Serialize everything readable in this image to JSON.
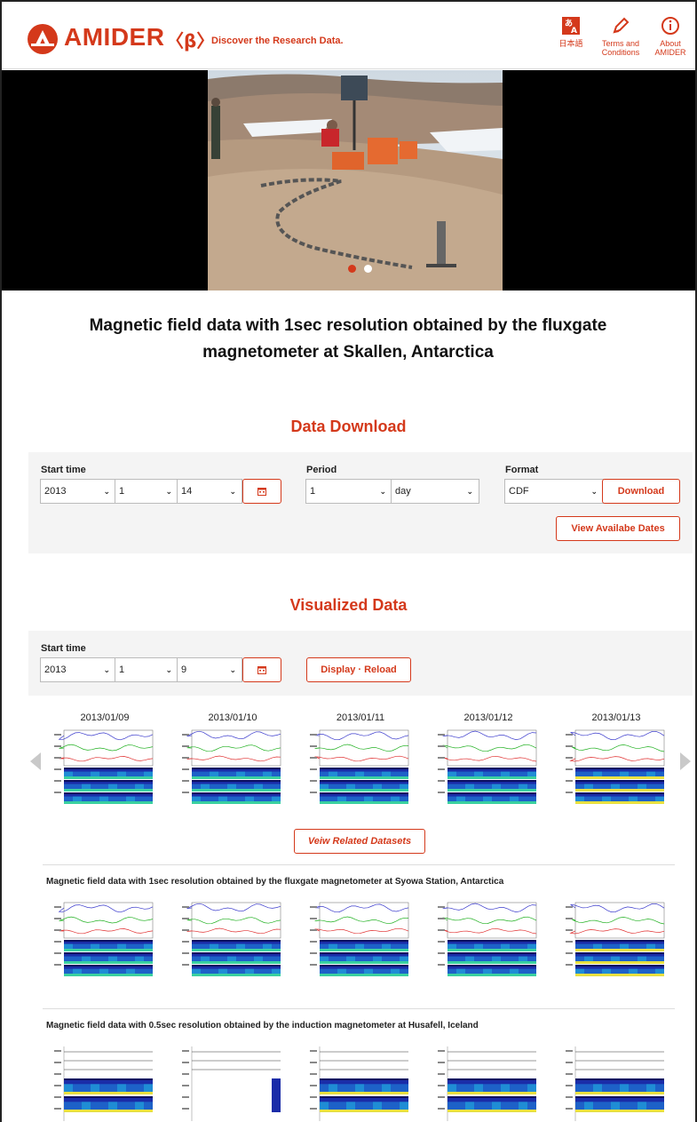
{
  "header": {
    "brand": "AMIDER",
    "beta": "〈β〉",
    "tagline": "Discover the Research Data.",
    "nav": [
      {
        "label": "日本語",
        "icon": "language-icon"
      },
      {
        "label": "Terms and Conditions",
        "icon": "pencil-icon"
      },
      {
        "label": "About AMIDER",
        "icon": "info-icon"
      }
    ],
    "colors": {
      "accent": "#d4391b"
    }
  },
  "hero": {
    "slides": 2,
    "active_slide": 1
  },
  "title": "Magnetic field data with 1sec resolution obtained by the fluxgate magnetometer at Skallen, Antarctica",
  "download": {
    "heading": "Data Download",
    "start_time_label": "Start time",
    "year": "2013",
    "month": "1",
    "day": "14",
    "period_label": "Period",
    "period_value": "1",
    "period_unit": "day",
    "format_label": "Format",
    "format_value": "CDF",
    "download_button": "Download",
    "view_dates_button": "View Availabe Dates"
  },
  "visualized": {
    "heading": "Visualized Data",
    "start_time_label": "Start time",
    "year": "2013",
    "month": "1",
    "day": "9",
    "reload_button": "Display · Reload",
    "dates": [
      "2013/01/09",
      "2013/01/10",
      "2013/01/11",
      "2013/01/12",
      "2013/01/13"
    ],
    "related_button": "Veiw Related Datasets"
  },
  "related": [
    {
      "title": "Magnetic field data with 1sec resolution obtained by the fluxgate magnetometer at Syowa Station, Antarctica"
    },
    {
      "title": "Magnetic field data with 0.5sec resolution obtained by the induction magnetometer at Husafell, Iceland"
    }
  ]
}
